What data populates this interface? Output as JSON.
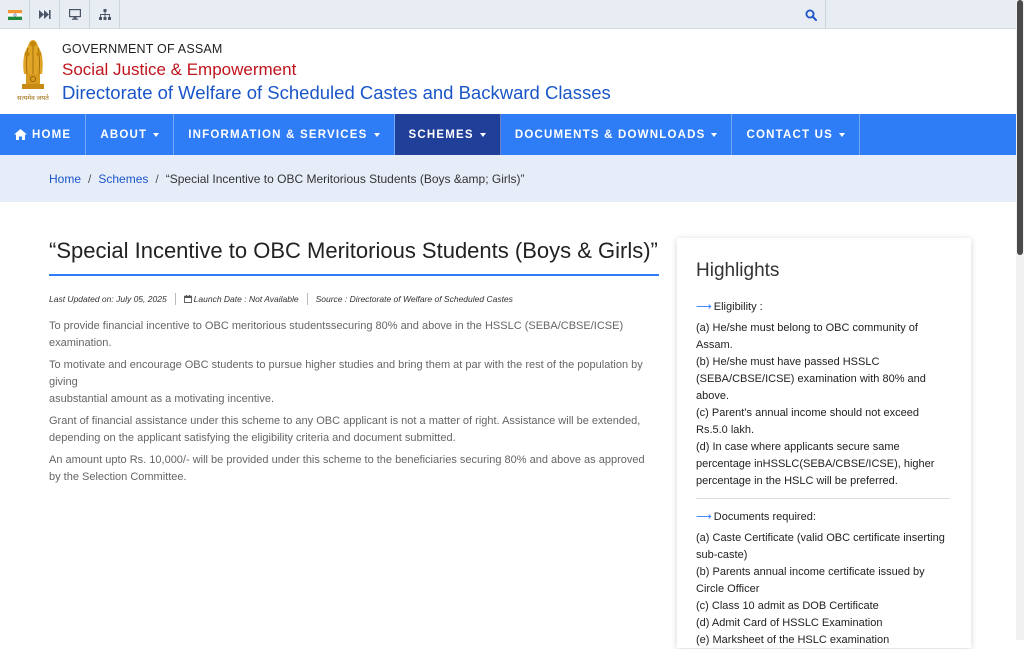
{
  "topbar": {
    "icons": [
      "india-flag-icon",
      "skip-forward-icon",
      "monitor-icon",
      "sitemap-icon"
    ],
    "search_icon": "search-icon"
  },
  "header": {
    "government": "GOVERNMENT OF ASSAM",
    "department": "Social Justice & Empowerment",
    "directorate": "Directorate of Welfare of Scheduled Castes and Backward Classes",
    "emblem_motto": "सत्यमेव जयते"
  },
  "nav": {
    "items": [
      {
        "label": "HOME"
      },
      {
        "label": "ABOUT"
      },
      {
        "label": "INFORMATION & SERVICES"
      },
      {
        "label": "SCHEMES"
      },
      {
        "label": "DOCUMENTS & DOWNLOADS"
      },
      {
        "label": "CONTACT US"
      }
    ]
  },
  "breadcrumb": {
    "home": "Home",
    "schemes": "Schemes",
    "current": "“Special Incentive to OBC Meritorious Students (Boys &amp; Girls)”"
  },
  "article": {
    "title": "“Special Incentive to OBC Meritorious Students (Boys & Girls)”",
    "last_updated": "Last Updated on: July 05, 2025",
    "launch_date": "Launch Date : Not Available",
    "source": "Source : Directorate of Welfare of Scheduled Castes",
    "paragraphs": [
      "To provide financial incentive to OBC meritorious studentssecuring 80% and above in the HSSLC (SEBA/CBSE/ICSE) examination.",
      "To motivate and encourage OBC students to pursue higher studies and bring them at par with the rest of the population by giving",
      "asubstantial amount as a motivating incentive.",
      "Grant of financial assistance under this scheme to any OBC applicant is not a matter of right. Assistance will be extended, depending on the applicant satisfying the eligibility criteria and document submitted.",
      "An amount upto Rs. 10,000/- will be provided under this scheme to the beneficiaries securing 80% and above as approved by the Selection Committee."
    ]
  },
  "highlights": {
    "title": "Highlights",
    "eligibility_heading": "Eligibility :",
    "eligibility": [
      "(a) He/she must belong to OBC community of Assam.",
      "(b) He/she must have passed HSSLC (SEBA/CBSE/ICSE) examination with 80% and above.",
      "(c) Parent’s annual income should not exceed Rs.5.0 lakh.",
      "(d) In case where applicants secure same percentage inHSSLC(SEBA/CBSE/ICSE), higher percentage in the HSLC will be preferred."
    ],
    "documents_heading": "Documents required:",
    "documents": [
      "(a) Caste Certificate (valid OBC certificate inserting sub-caste)",
      "(b) Parents annual income certificate issued by Circle Officer",
      "(c) Class 10 admit as DOB Certificate",
      "(d) Admit Card of HSSLC Examination",
      "(e) Marksheet of the HSLC examination"
    ]
  },
  "colors": {
    "nav": "#2e7cf6",
    "nav_active": "#1f3f99",
    "department": "#c0141c",
    "directorate": "#1a56c9",
    "breadcrumb_bg": "#e6edf8"
  }
}
